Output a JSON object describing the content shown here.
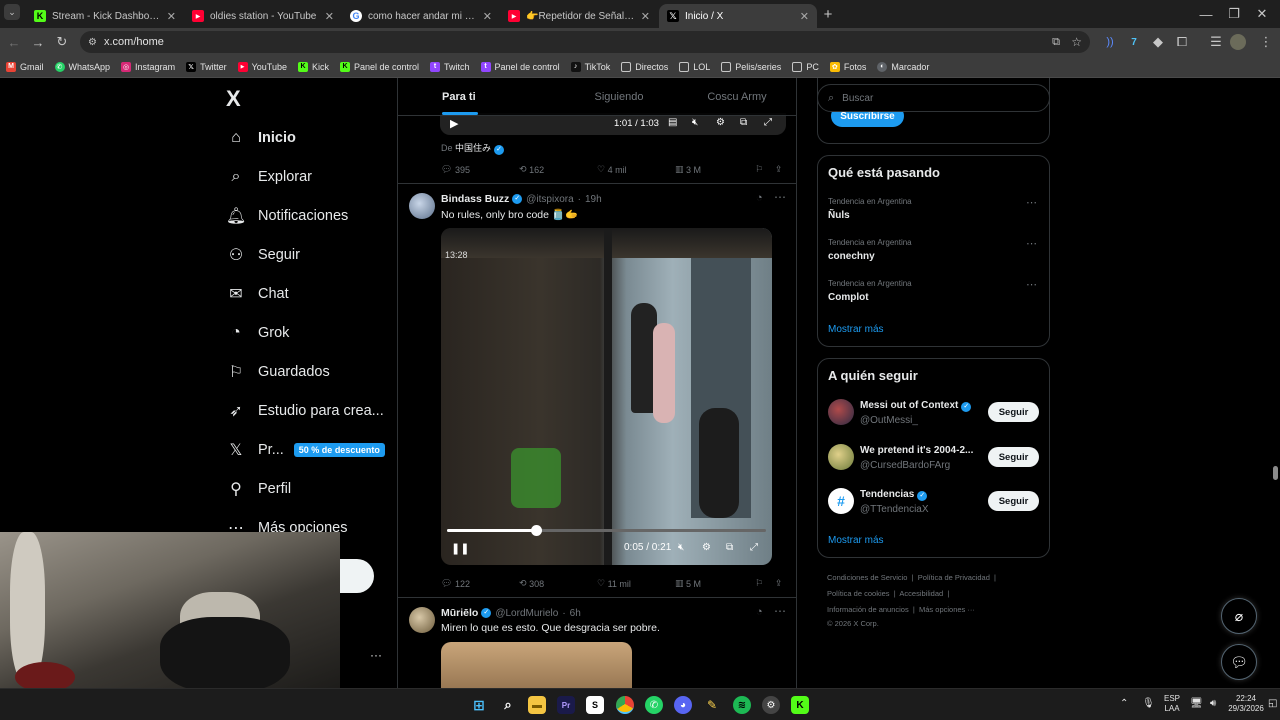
{
  "browser": {
    "tabs": [
      {
        "title": "Stream - Kick Dashboard",
        "color": "#53fc18",
        "glyph": "K"
      },
      {
        "title": "oldies station - YouTube",
        "color": "#ff0033",
        "glyph": "▶"
      },
      {
        "title": "como hacer andar mi repetidor",
        "color": "#e8eaed",
        "glyph": "G"
      },
      {
        "title": "👉Repetidor de Señal WIFI, Có",
        "color": "#ff0033",
        "glyph": "▶"
      },
      {
        "title": "Inicio / X",
        "color": "#000000",
        "glyph": "𝕏"
      }
    ],
    "new_tab": "+",
    "url": "x.com/home",
    "window_controls": [
      "—",
      "❐",
      "✕"
    ],
    "bookmarks": [
      {
        "label": "Gmail",
        "color": "#ea4335",
        "glyph": "M"
      },
      {
        "label": "WhatsApp",
        "color": "#25d366",
        "glyph": "✆"
      },
      {
        "label": "Instagram",
        "color": "#d62976",
        "glyph": "◎"
      },
      {
        "label": "Twitter",
        "color": "#000000",
        "glyph": "𝕏"
      },
      {
        "label": "YouTube",
        "color": "#ff0033",
        "glyph": "▶"
      },
      {
        "label": "Kick",
        "color": "#53fc18",
        "glyph": "K"
      },
      {
        "label": "Panel de control",
        "color": "#53fc18",
        "glyph": "K"
      },
      {
        "label": "Twitch",
        "color": "#9146ff",
        "glyph": "t"
      },
      {
        "label": "Panel de control",
        "color": "#9146ff",
        "glyph": "t"
      },
      {
        "label": "TikTok",
        "color": "#111111",
        "glyph": "♪"
      },
      {
        "label": "Directos",
        "color": "#5f6368",
        "glyph": "▭"
      },
      {
        "label": "LOL",
        "color": "#5f6368",
        "glyph": "▭"
      },
      {
        "label": "Pelis/series",
        "color": "#5f6368",
        "glyph": "▭"
      },
      {
        "label": "PC",
        "color": "#5f6368",
        "glyph": "▭"
      },
      {
        "label": "Fotos",
        "color": "#fbbc04",
        "glyph": "✿"
      },
      {
        "label": "Marcador",
        "color": "#5f6368",
        "glyph": "◐"
      }
    ]
  },
  "nav": {
    "logo": "X",
    "items": [
      {
        "label": "Inicio",
        "icon": "⌂"
      },
      {
        "label": "Explorar",
        "icon": "⌕"
      },
      {
        "label": "Notificaciones",
        "icon": "🔔"
      },
      {
        "label": "Seguir",
        "icon": "👤"
      },
      {
        "label": "Chat",
        "icon": "✉"
      },
      {
        "label": "Grok",
        "icon": "◔"
      },
      {
        "label": "Guardados",
        "icon": "🔖"
      },
      {
        "label": "Estudio para crea...",
        "icon": "🚀"
      },
      {
        "label": "Pr...",
        "icon": "𝕏"
      },
      {
        "label": "Perfil",
        "icon": "👤"
      },
      {
        "label": "Más opciones",
        "icon": "⋯"
      }
    ],
    "promo_badge": "50 % de descuento",
    "more_dots": "···"
  },
  "feed": {
    "tabs": [
      "Para ti",
      "Siguiendo",
      "Coscu Army"
    ],
    "top_post": {
      "video_time": "1:01 / 1:03",
      "via_prefix": "De",
      "via_name": "中国住み",
      "replies": "395",
      "reposts": "162",
      "likes": "4 mil",
      "views": "3 M"
    },
    "post1": {
      "name": "Bindass Buzz",
      "handle": "@itspixora",
      "time": "19h",
      "text": "No rules, only bro code 🫙🫱",
      "video_overlay_time": "13:28",
      "video_time": "0:05 / 0:21",
      "progress": 0.28,
      "replies": "122",
      "reposts": "308",
      "likes": "11 mil",
      "views": "5 M"
    },
    "post2": {
      "name": "Mūriēlo",
      "handle": "@LordMurielo",
      "time": "6h",
      "text": "Miren lo que es esto. Que desgracia ser pobre."
    }
  },
  "right": {
    "search_placeholder": "Buscar",
    "subscribe": "Suscribirse",
    "trends_title": "Qué está pasando",
    "trends": [
      {
        "context": "Tendencia en Argentina",
        "name": "Ñuls"
      },
      {
        "context": "Tendencia en Argentina",
        "name": "conechny"
      },
      {
        "context": "Tendencia en Argentina",
        "name": "Complot"
      }
    ],
    "show_more": "Mostrar más",
    "follow_title": "A quién seguir",
    "follow": [
      {
        "name": "Messi out of Context",
        "handle": "@OutMessi_",
        "button": "Seguir"
      },
      {
        "name": "We pretend it's 2004-2...",
        "handle": "@CursedBardoFArg",
        "button": "Seguir"
      },
      {
        "name": "Tendencias",
        "handle": "@TTendenciaX",
        "button": "Seguir"
      }
    ],
    "footer": {
      "line1a": "Condiciones de Servicio",
      "line1b": "Política de Privacidad",
      "line2a": "Política de cookies",
      "line2b": "Accesibilidad",
      "line3a": "Información de anuncios",
      "line3b": "Más opciones ···",
      "copyright": "© 2026 X Corp."
    }
  },
  "taskbar": {
    "lang_top": "ESP",
    "lang_bottom": "LAA",
    "time": "22:24",
    "date": "29/3/2026"
  }
}
